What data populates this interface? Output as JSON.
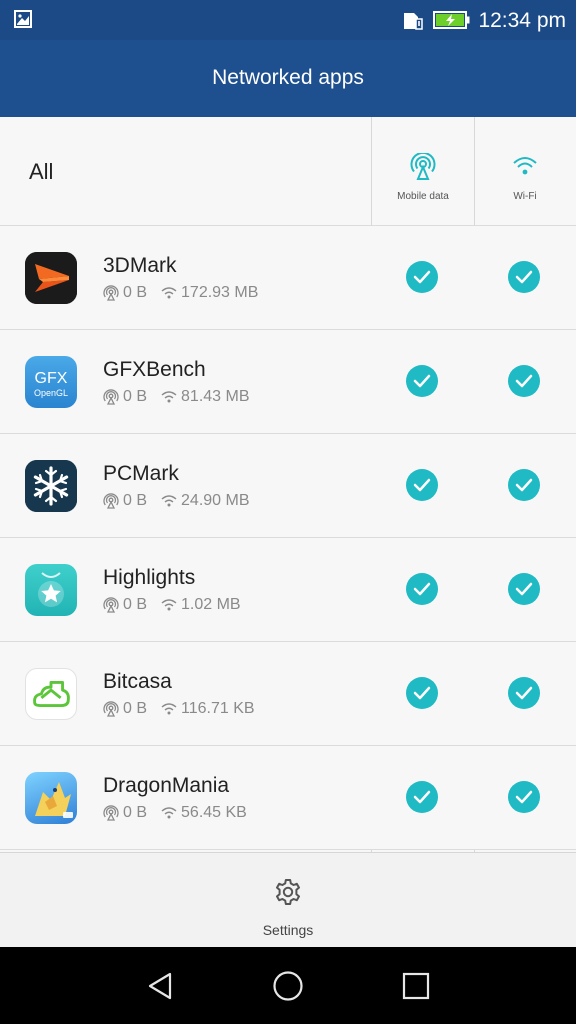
{
  "status_bar": {
    "time": "12:34 pm",
    "icons": [
      "image-icon",
      "sim-icon",
      "battery-charging-icon"
    ],
    "battery_color": "#6ccf2a"
  },
  "app_bar": {
    "title": "Networked apps"
  },
  "header": {
    "all_label": "All",
    "col_mobile": "Mobile data",
    "col_wifi": "Wi-Fi"
  },
  "apps": [
    {
      "name": "3DMark",
      "mobile": "0 B",
      "wifi": "172.93 MB",
      "icon": "3dmark-icon",
      "mobile_enabled": true,
      "wifi_enabled": true
    },
    {
      "name": "GFXBench",
      "mobile": "0 B",
      "wifi": "81.43 MB",
      "icon": "gfxbench-icon",
      "mobile_enabled": true,
      "wifi_enabled": true
    },
    {
      "name": "PCMark",
      "mobile": "0 B",
      "wifi": "24.90 MB",
      "icon": "pcmark-icon",
      "mobile_enabled": true,
      "wifi_enabled": true
    },
    {
      "name": "Highlights",
      "mobile": "0 B",
      "wifi": "1.02 MB",
      "icon": "highlights-icon",
      "mobile_enabled": true,
      "wifi_enabled": true
    },
    {
      "name": "Bitcasa",
      "mobile": "0 B",
      "wifi": "116.71 KB",
      "icon": "bitcasa-icon",
      "mobile_enabled": true,
      "wifi_enabled": true
    },
    {
      "name": "DragonMania",
      "mobile": "0 B",
      "wifi": "56.45 KB",
      "icon": "dragonmania-icon",
      "mobile_enabled": true,
      "wifi_enabled": true
    }
  ],
  "gfx_icon_text": {
    "line1": "GFX",
    "line2": "OpenGL"
  },
  "bottom_bar": {
    "settings_label": "Settings"
  },
  "nav_bar": {
    "buttons": [
      "back-icon",
      "home-icon",
      "recents-icon"
    ]
  },
  "colors": {
    "primary": "#1e4f8e",
    "accent": "#1fbac4"
  }
}
